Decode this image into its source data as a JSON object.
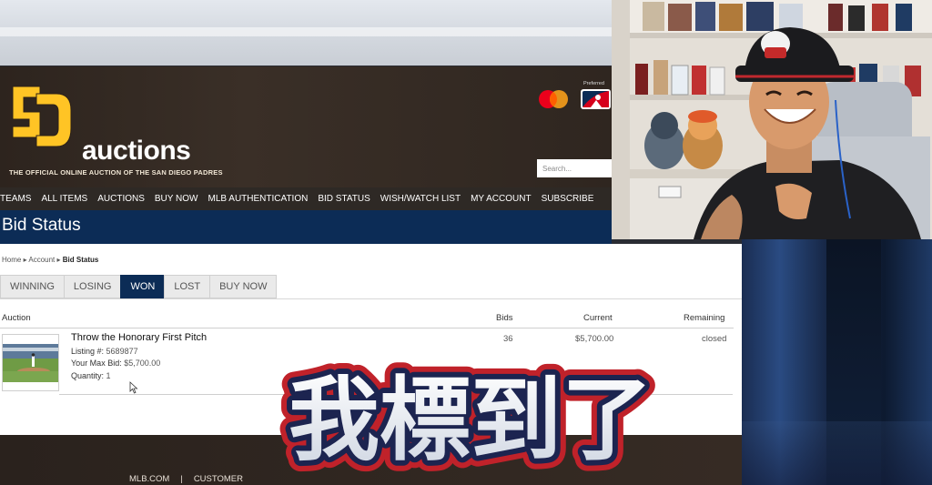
{
  "site": {
    "brand_word": "auctions",
    "tagline": "THE OFFICIAL ONLINE AUCTION OF THE SAN DIEGO PADRES",
    "preferred_label": "Preferred",
    "search": {
      "placeholder": "Search..."
    },
    "nav": [
      "TEAMS",
      "ALL ITEMS",
      "AUCTIONS",
      "BUY NOW",
      "MLB AUTHENTICATION",
      "BID STATUS",
      "WISH/WATCH LIST",
      "MY ACCOUNT",
      "SUBSCRIBE"
    ],
    "page_title": "Bid Status",
    "breadcrumb": {
      "home": "Home",
      "account": "Account",
      "current": "Bid Status"
    },
    "tabs": [
      {
        "label": "WINNING",
        "active": false
      },
      {
        "label": "LOSING",
        "active": false
      },
      {
        "label": "WON",
        "active": true
      },
      {
        "label": "LOST",
        "active": false
      },
      {
        "label": "BUY NOW",
        "active": false
      }
    ],
    "table": {
      "headers": {
        "auction": "Auction",
        "bids": "Bids",
        "current": "Current",
        "remaining": "Remaining"
      },
      "rows": [
        {
          "title": "Throw the Honorary First Pitch",
          "listing_label": "Listing #:",
          "listing_value": "5689877",
          "max_bid_label": "Your Max Bid:",
          "max_bid_value": "$5,700.00",
          "quantity_label": "Quantity:",
          "quantity_value": "1",
          "bids": "36",
          "current": "$5,700.00",
          "remaining": "closed"
        }
      ]
    },
    "footer": {
      "link1": "MLB.COM",
      "separator": "|",
      "link2": "CUSTOMER"
    }
  },
  "caption": {
    "text": "我標到了"
  },
  "colors": {
    "padres_brown": "#2f241e",
    "padres_gold": "#ffc425",
    "navy": "#0c2c56",
    "caption_outline": "#d2232a"
  },
  "icons": [
    "sd-logo",
    "mastercard-logo",
    "mlb-logo",
    "mouse-cursor-icon"
  ]
}
